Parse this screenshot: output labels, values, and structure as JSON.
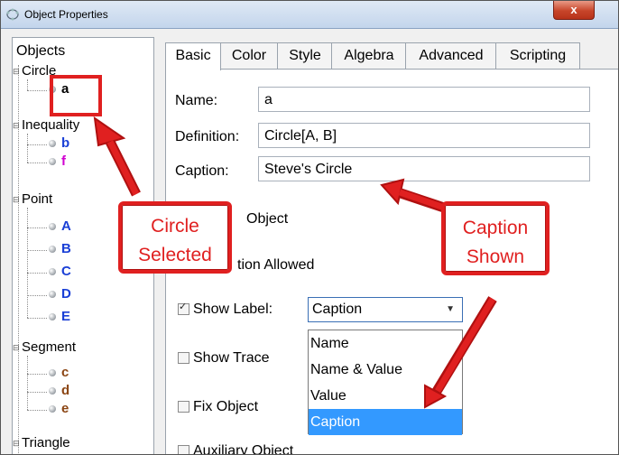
{
  "window": {
    "title": "Object Properties",
    "close_label": "x"
  },
  "tree": {
    "root": "Objects",
    "categories": [
      {
        "label": "Circle",
        "items": [
          {
            "name": "a",
            "color": "#000000"
          }
        ]
      },
      {
        "label": "Inequality",
        "items": [
          {
            "name": "b",
            "color": "#1a3fd6"
          },
          {
            "name": "f",
            "color": "#d000d0"
          }
        ]
      },
      {
        "label": "Point",
        "items": [
          {
            "name": "A",
            "color": "#1a3fd6"
          },
          {
            "name": "B",
            "color": "#1a3fd6"
          },
          {
            "name": "C",
            "color": "#1a3fd6"
          },
          {
            "name": "D",
            "color": "#1a3fd6"
          },
          {
            "name": "E",
            "color": "#1a3fd6"
          }
        ]
      },
      {
        "label": "Segment",
        "items": [
          {
            "name": "c",
            "color": "#8b4513"
          },
          {
            "name": "d",
            "color": "#8b4513"
          },
          {
            "name": "e",
            "color": "#8b4513"
          }
        ]
      },
      {
        "label": "Triangle",
        "items": []
      }
    ]
  },
  "tabs": [
    "Basic",
    "Color",
    "Style",
    "Algebra",
    "Advanced",
    "Scripting"
  ],
  "basic": {
    "name_label": "Name:",
    "name_value": "a",
    "definition_label": "Definition:",
    "definition_value": "Circle[A, B]",
    "caption_label": "Caption:",
    "caption_value": "Steve's Circle",
    "show_object_partial": "Object",
    "selection_allowed_partial": "tion Allowed",
    "show_label": "Show Label:",
    "show_label_checked": true,
    "show_label_value": "Caption",
    "show_label_options": [
      "Name",
      "Name & Value",
      "Value",
      "Caption"
    ],
    "show_trace": "Show Trace",
    "fix_object": "Fix Object",
    "auxiliary_object": "Auxiliary Object"
  },
  "callouts": {
    "circle_selected": [
      "Circle",
      "Selected"
    ],
    "caption_shown": [
      "Caption",
      "Shown"
    ]
  },
  "colors": {
    "annotation_red": "#e02020",
    "selection_blue": "#3399ff"
  }
}
